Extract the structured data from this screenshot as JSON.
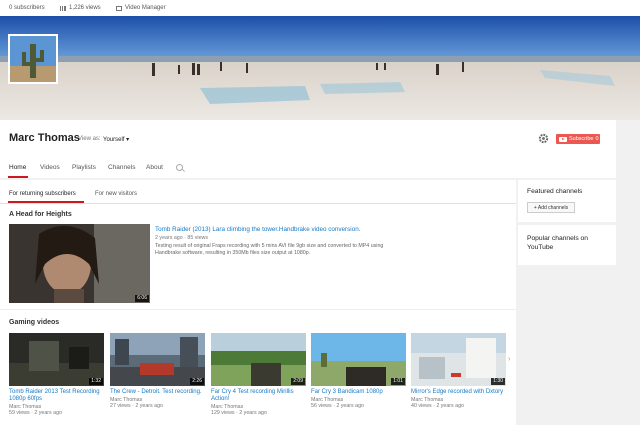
{
  "stats": {
    "subscribers": "0 subscribers",
    "views": "1,226 views",
    "video_manager": "Video Manager"
  },
  "channel": {
    "name": "Marc Thomas",
    "view_as_label": "View as:",
    "view_as_value": "Yourself",
    "subscribe_label": "Subscribe",
    "subscribe_count": "0",
    "gplus": "G+"
  },
  "tabs": [
    "Home",
    "Videos",
    "Playlists",
    "Channels",
    "About"
  ],
  "subtabs": [
    "For returning subscribers",
    "For new visitors"
  ],
  "featured": {
    "section_title": "A Head for Heights",
    "title": "Tomb Raider (2013) Lara climbing the tower.Handbrake video conversion.",
    "meta": "2 years ago · 85 views",
    "description": "Testing result of original Fraps recording with 5 mins AVI file 9gb size and converted to MP4 using Handbrake software, resulting in 350Mb files size output at 1080p.",
    "duration": "6:06"
  },
  "gaming": {
    "section_title": "Gaming videos",
    "videos": [
      {
        "title": "Tomb Raider 2013 Test Recording 1080p 60fps",
        "channel": "Marc Thomas",
        "meta": "59 views · 2 years ago",
        "duration": "1:32"
      },
      {
        "title": "The Crew - Detroit. Test recording.",
        "channel": "Marc Thomas",
        "meta": "27 views · 2 years ago",
        "duration": "2:26"
      },
      {
        "title": "Far Cry 4 Test recording Mirillis Action!",
        "channel": "Marc Thomas",
        "meta": "129 views · 2 years ago",
        "duration": "2:09"
      },
      {
        "title": "Far Cry 3 Bandicam 1080p",
        "channel": "Marc Thomas",
        "meta": "56 views · 2 years ago",
        "duration": "1:01"
      },
      {
        "title": "Mirror's Edge recorded with Dxtory",
        "channel": "Marc Thomas",
        "meta": "40 views · 2 years ago",
        "duration": "1:30"
      }
    ]
  },
  "sidebar": {
    "featured_title": "Featured channels",
    "add_channels": "+ Add channels",
    "popular_title": "Popular channels on YouTube"
  },
  "colors": {
    "accent": "#cc181e",
    "link": "#167ac6",
    "subscribe": "#e62117"
  }
}
